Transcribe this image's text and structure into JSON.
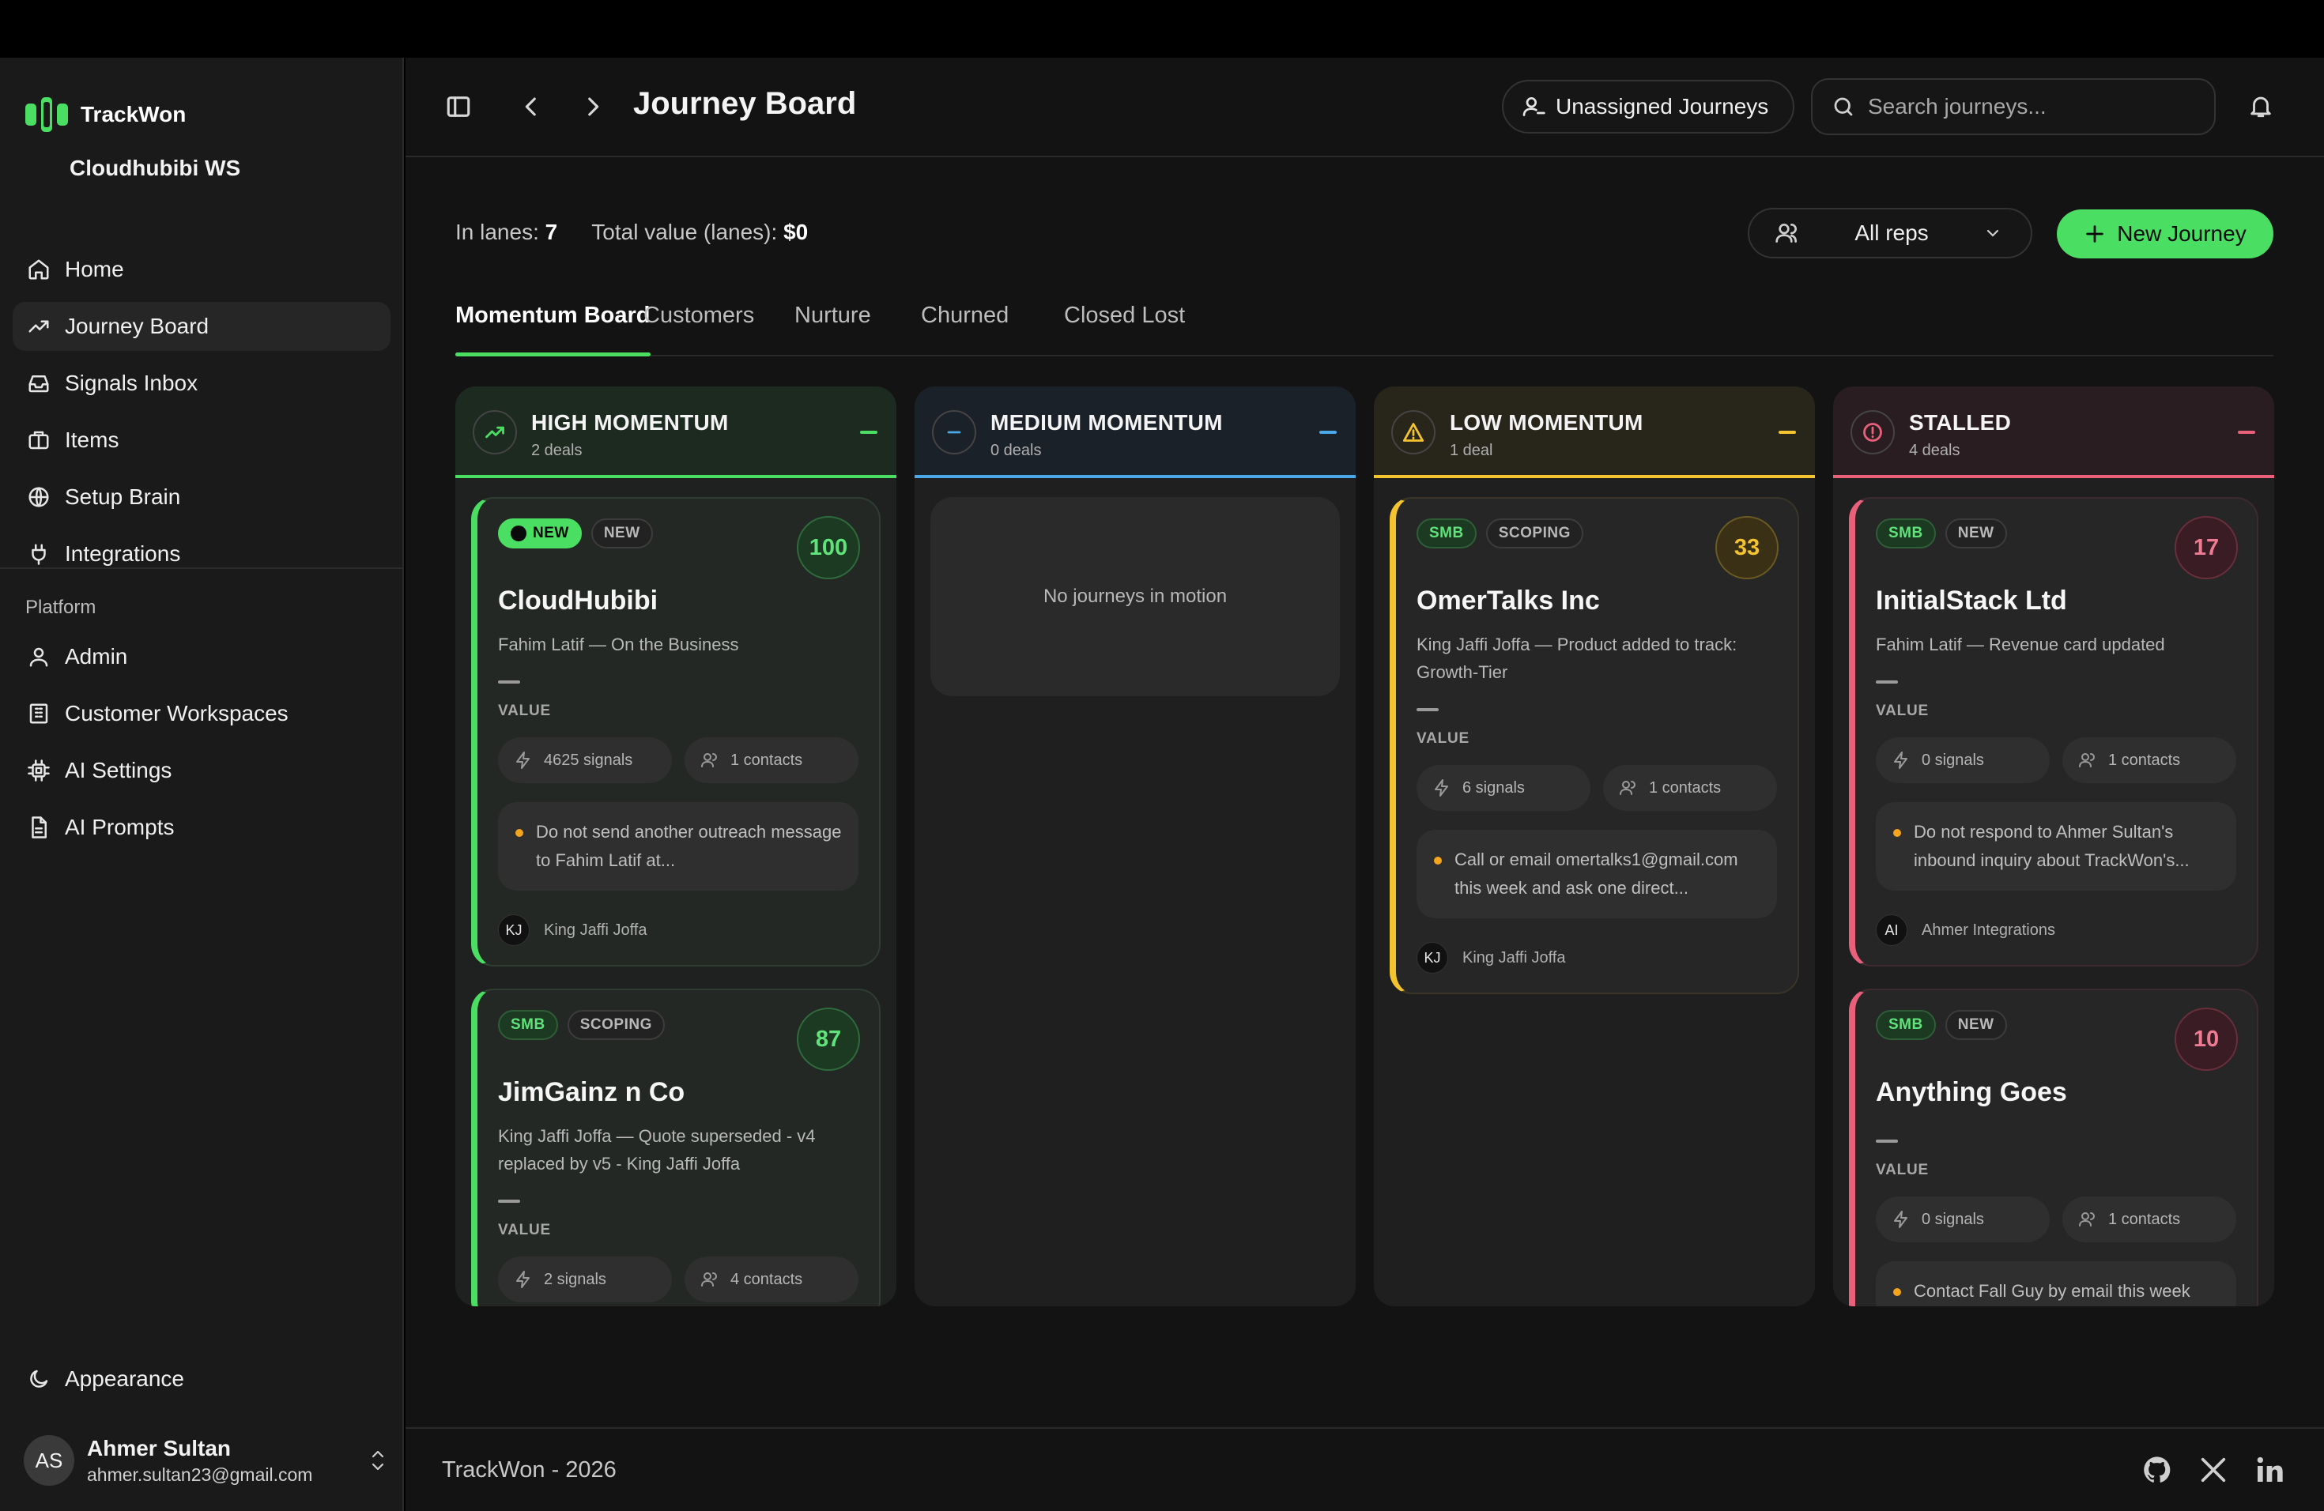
{
  "app": {
    "name": "TrackWon",
    "workspace": "Cloudhubibi WS"
  },
  "sidebar": {
    "nav": [
      {
        "label": "Home",
        "icon": "home-icon"
      },
      {
        "label": "Journey Board",
        "icon": "trending-up-icon",
        "active": true
      },
      {
        "label": "Signals Inbox",
        "icon": "inbox-icon"
      },
      {
        "label": "Items",
        "icon": "package-icon"
      },
      {
        "label": "Setup Brain",
        "icon": "brain-icon"
      },
      {
        "label": "Integrations",
        "icon": "plug-icon"
      }
    ],
    "section_label": "Platform",
    "platform": [
      {
        "label": "Admin",
        "icon": "users-icon"
      },
      {
        "label": "Customer Workspaces",
        "icon": "building-icon"
      },
      {
        "label": "AI Settings",
        "icon": "cpu-icon"
      },
      {
        "label": "AI Prompts",
        "icon": "file-text-icon"
      }
    ],
    "appearance": {
      "label": "Appearance",
      "icon": "moon-icon"
    },
    "user": {
      "initials": "AS",
      "name": "Ahmer Sultan",
      "email": "ahmer.sultan23@gmail.com"
    }
  },
  "header": {
    "title": "Journey Board",
    "unassigned_label": "Unassigned Journeys",
    "search_placeholder": "Search journeys..."
  },
  "stats": {
    "in_lanes_label": "In lanes:",
    "in_lanes_value": "7",
    "total_label": "Total value (lanes):",
    "total_value": "$0"
  },
  "filters": {
    "reps_label": "All reps",
    "new_journey_label": "New Journey"
  },
  "tabs": [
    {
      "label": "Momentum Board",
      "active": true
    },
    {
      "label": "Customers"
    },
    {
      "label": "Nurture"
    },
    {
      "label": "Churned"
    },
    {
      "label": "Closed Lost"
    }
  ],
  "colors": {
    "accent_green": "#4ade63",
    "medium_blue": "#4aa8e8",
    "low_yellow": "#f4c430",
    "stalled_red": "#e8607a",
    "advice_dot": "#f4a51c"
  },
  "lanes": [
    {
      "title": "HIGH MOMENTUM",
      "count": "2 deals",
      "icon": "trending-up-icon",
      "cards": [
        {
          "tier": "NEW",
          "stage": "NEW",
          "score": "100",
          "company": "CloudHubibi",
          "summary": "Fahim Latif — On the Business",
          "value_label": "VALUE",
          "signals": "4625 signals",
          "contacts": "1 contacts",
          "advice": "Do not send another outreach message to Fahim Latif at...",
          "owner_initials": "KJ",
          "owner": "King Jaffi Joffa"
        },
        {
          "tier": "SMB",
          "stage": "SCOPING",
          "score": "87",
          "company": "JimGainz n Co",
          "summary": "King Jaffi Joffa — Quote superseded - v4 replaced by v5 - King Jaffi Joffa",
          "value_label": "VALUE",
          "signals": "2 signals",
          "contacts": "4 contacts"
        }
      ]
    },
    {
      "title": "MEDIUM MOMENTUM",
      "count": "0 deals",
      "icon": "minus-icon",
      "empty_text": "No journeys in motion"
    },
    {
      "title": "LOW MOMENTUM",
      "count": "1 deal",
      "icon": "alert-triangle-icon",
      "cards": [
        {
          "tier": "SMB",
          "stage": "SCOPING",
          "score": "33",
          "company": "OmerTalks Inc",
          "summary": "King Jaffi Joffa — Product added to track: Growth-Tier",
          "value_label": "VALUE",
          "signals": "6 signals",
          "contacts": "1 contacts",
          "advice": "Call or email omertalks1@gmail.com this week and ask one direct...",
          "owner_initials": "KJ",
          "owner": "King Jaffi Joffa"
        }
      ]
    },
    {
      "title": "STALLED",
      "count": "4 deals",
      "icon": "alert-circle-icon",
      "cards": [
        {
          "tier": "SMB",
          "stage": "NEW",
          "score": "17",
          "company": "InitialStack Ltd",
          "summary": "Fahim Latif — Revenue card updated",
          "value_label": "VALUE",
          "signals": "0 signals",
          "contacts": "1 contacts",
          "advice": "Do not respond to Ahmer Sultan's inbound inquiry about TrackWon's...",
          "owner_initials": "AI",
          "owner": "Ahmer Integrations"
        },
        {
          "tier": "SMB",
          "stage": "NEW",
          "score": "10",
          "company": "Anything Goes",
          "summary": "",
          "value_label": "VALUE",
          "signals": "0 signals",
          "contacts": "1 contacts",
          "advice": "Contact Fall Guy by email this week"
        }
      ]
    }
  ],
  "footer": {
    "text": "TrackWon - 2026",
    "links": [
      "github-icon",
      "x-icon",
      "linkedin-icon"
    ]
  }
}
